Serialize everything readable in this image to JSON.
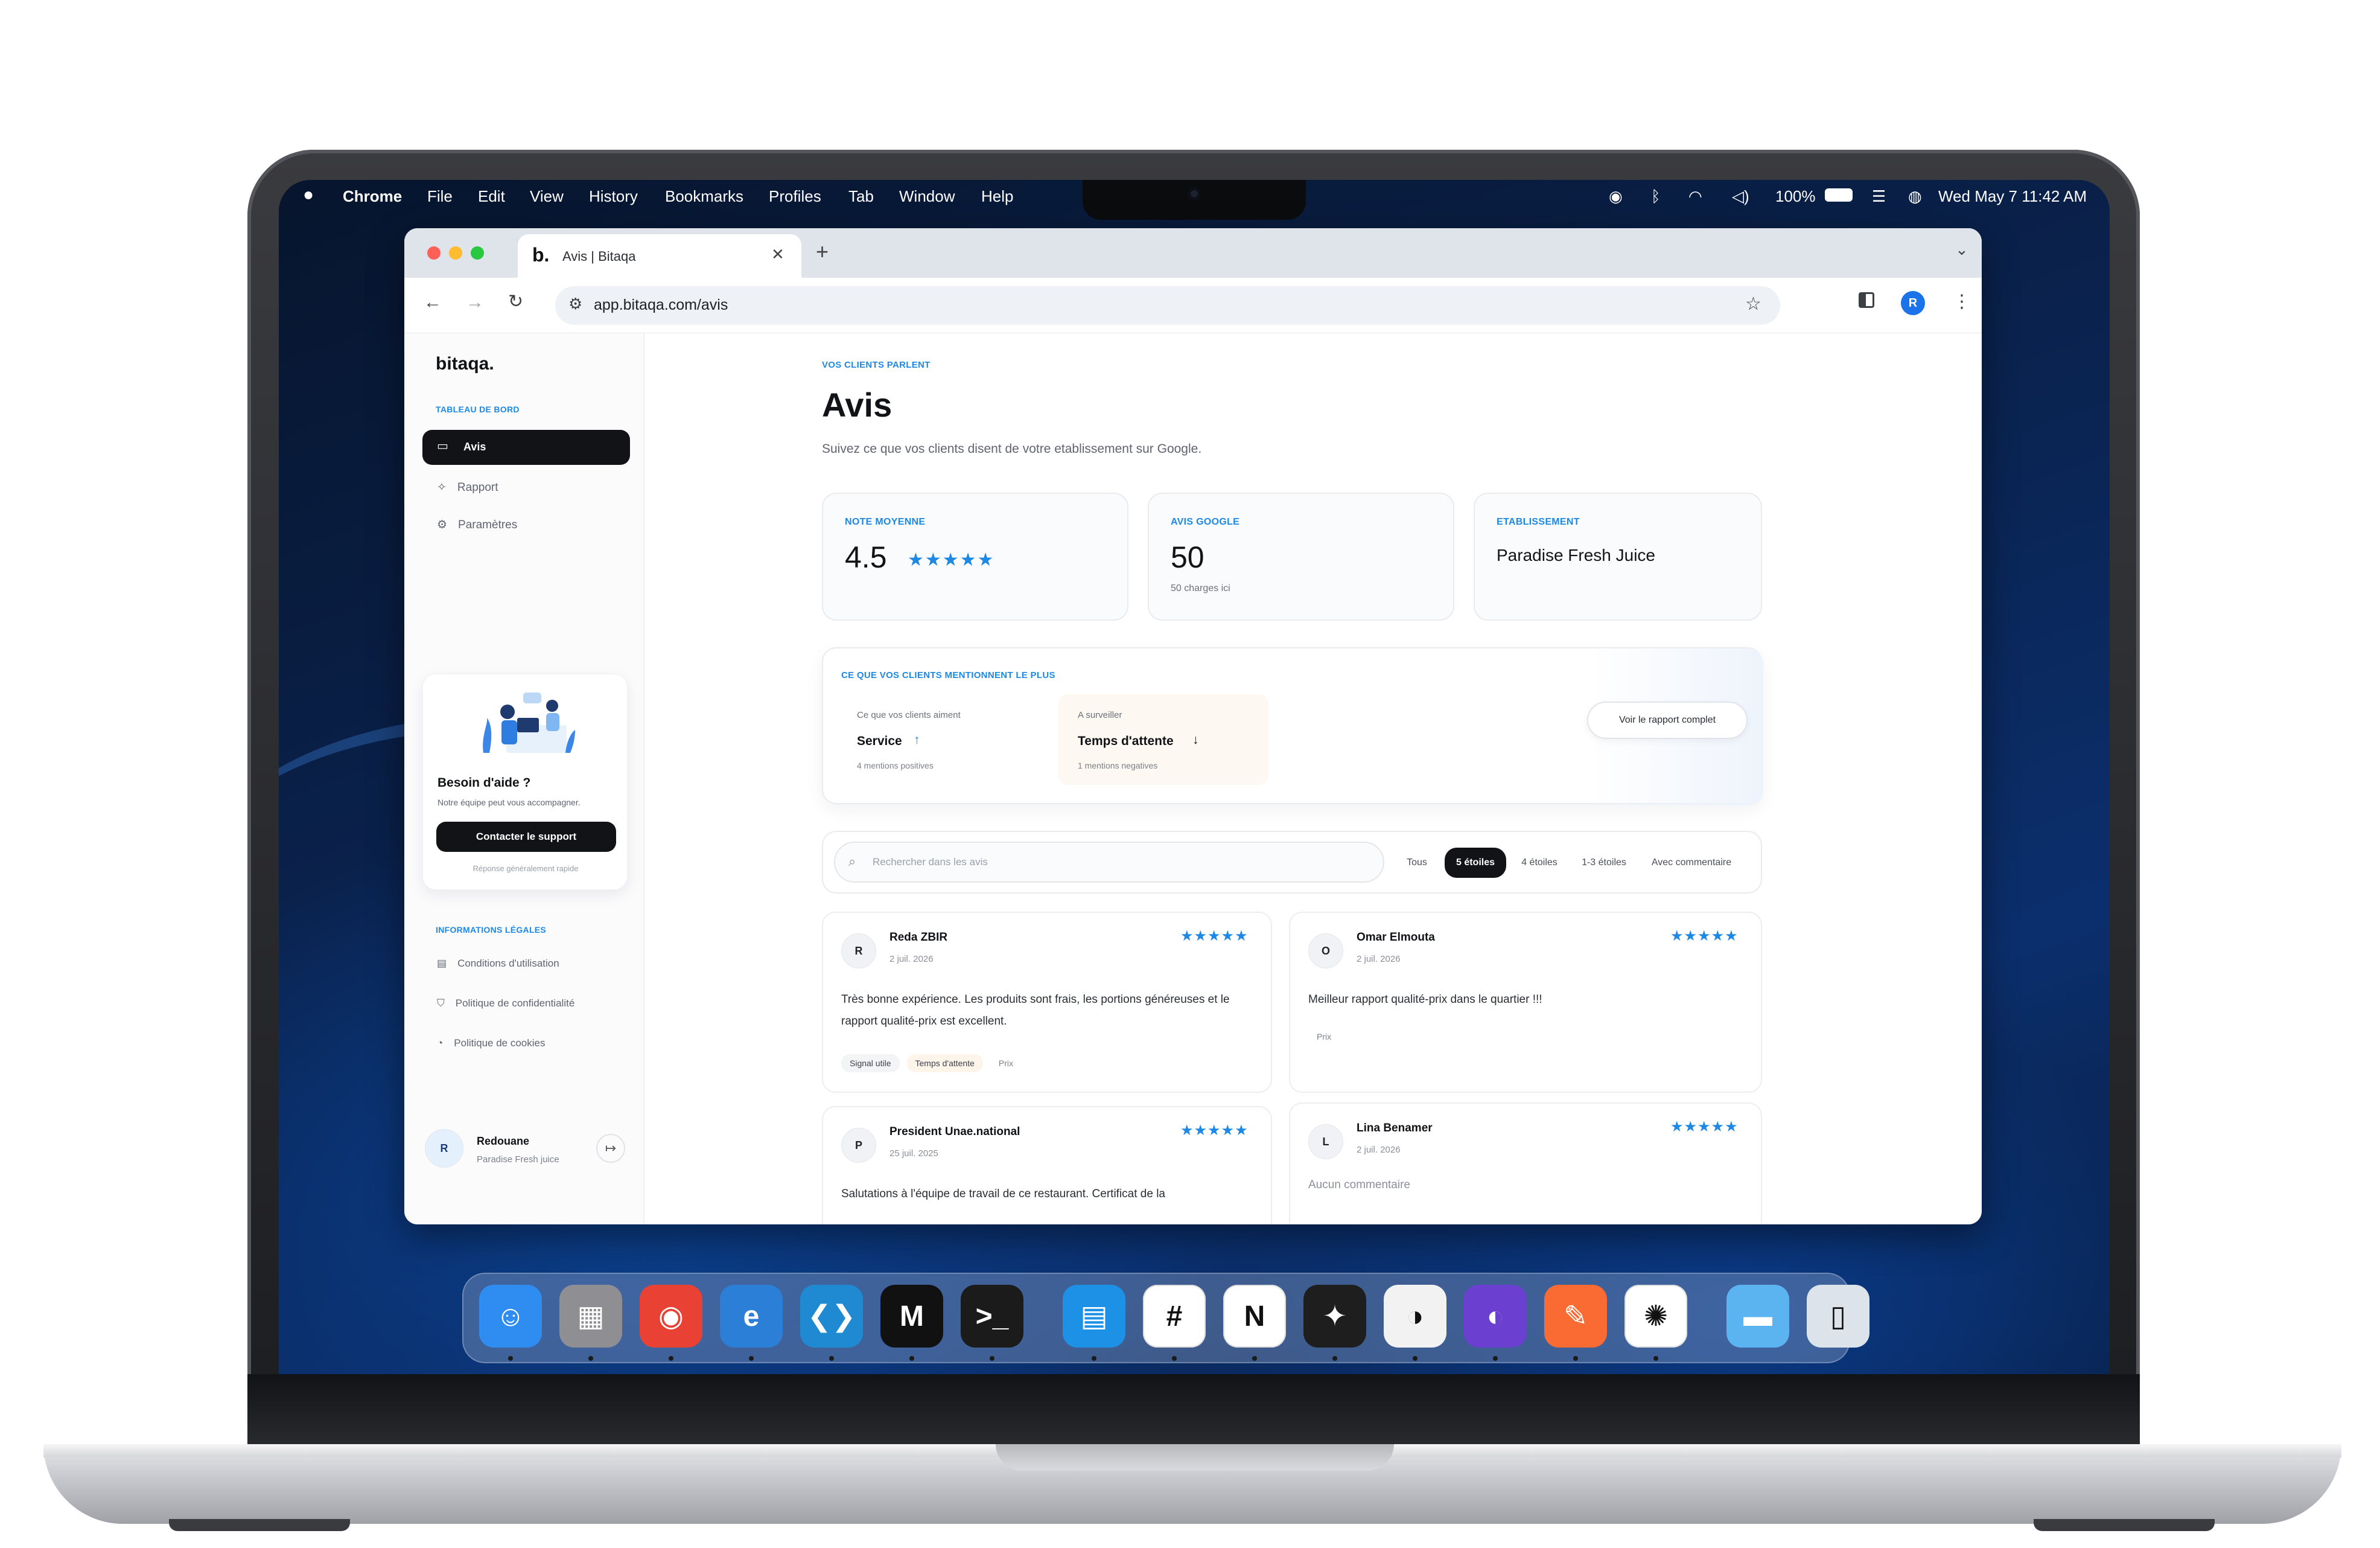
{
  "menubar": {
    "app": "Chrome",
    "items": [
      "File",
      "Edit",
      "View",
      "History",
      "Bookmarks",
      "Profiles",
      "Tab",
      "Window",
      "Help"
    ],
    "battery": "100%",
    "datetime": "Wed May 7  11:42 AM"
  },
  "browser": {
    "tab_title": "Avis | Bitaqa",
    "url": "app.bitaqa.com/avis",
    "profile_initial": "R"
  },
  "sidebar": {
    "logo": "bitaqa.",
    "section_dashboard": "TABLEAU DE BORD",
    "nav": [
      {
        "label": "Avis",
        "icon": "message-square-icon"
      },
      {
        "label": "Rapport",
        "icon": "sparkles-icon"
      },
      {
        "label": "Paramètres",
        "icon": "gear-icon"
      }
    ],
    "help": {
      "title": "Besoin d'aide ?",
      "text": "Notre équipe peut vous accompagner.",
      "button": "Contacter le support",
      "note": "Réponse généralement rapide"
    },
    "section_legal": "INFORMATIONS LÉGALES",
    "legal": [
      {
        "label": "Conditions d'utilisation",
        "icon": "document-icon"
      },
      {
        "label": "Politique de confidentialité",
        "icon": "shield-icon"
      },
      {
        "label": "Politique de cookies",
        "icon": "cookie-icon"
      }
    ],
    "user": {
      "initial": "R",
      "name": "Redouane",
      "business": "Paradise Fresh juice"
    }
  },
  "main": {
    "eyebrow": "VOS CLIENTS PARLENT",
    "title": "Avis",
    "subtitle": "Suivez ce que vos clients disent de votre etablissement sur Google.",
    "kpis": {
      "rating_title": "NOTE MOYENNE",
      "rating_value": "4.5",
      "rating_stars": "★★★★★",
      "google_title": "AVIS GOOGLE",
      "google_value": "50",
      "google_sub": "50 charges ici",
      "business_title": "ETABLISSEMENT",
      "business_value": "Paradise Fresh Juice"
    },
    "insights": {
      "title": "CE QUE VOS CLIENTS MENTIONNENT LE PLUS",
      "like_label": "Ce que vos clients aiment",
      "like_value": "Service",
      "like_arrow": "↑",
      "like_sub": "4 mentions positives",
      "watch_label": "A surveiller",
      "watch_value": "Temps d'attente",
      "watch_arrow": "↓",
      "watch_sub": "1 mentions negatives",
      "report_button": "Voir le rapport complet"
    },
    "search_placeholder": "Rechercher dans les avis",
    "filters": [
      "Tous",
      "5 étoiles",
      "4 étoiles",
      "1-3 étoiles",
      "Avec commentaire"
    ],
    "active_filter": "5 étoiles",
    "reviews": [
      {
        "initial": "R",
        "name": "Reda ZBIR",
        "date": "2 juil. 2026",
        "stars": "★★★★★",
        "text": "Très bonne expérience. Les produits sont frais, les portions généreuses et le rapport qualité-prix est excellent.",
        "tags": [
          "Signal utile",
          "Temps d'attente",
          "Prix"
        ]
      },
      {
        "initial": "O",
        "name": "Omar Elmouta",
        "date": "2 juil. 2026",
        "stars": "★★★★★",
        "text": "Meilleur rapport qualité-prix dans le quartier !!!",
        "tags": [
          "Prix"
        ]
      },
      {
        "initial": "P",
        "name": "President Unae.national",
        "date": "25 juil. 2025",
        "stars": "★★★★★",
        "text": "Salutations à l'équipe de travail de ce restaurant. Certificat de la",
        "tags": []
      },
      {
        "initial": "L",
        "name": "Lina Benamer",
        "date": "2 juil. 2026",
        "stars": "★★★★★",
        "text": "Aucun commentaire",
        "tags": []
      }
    ]
  },
  "dock": {
    "apps": [
      {
        "name": "finder-icon",
        "glyph": "☺",
        "color": "#2f8cf0"
      },
      {
        "name": "launchpad-icon",
        "glyph": "▦",
        "color": "#8e8e93"
      },
      {
        "name": "chrome-icon",
        "glyph": "◉",
        "color": "#e94235"
      },
      {
        "name": "edge-icon",
        "glyph": "e",
        "color": "#2b7fd6"
      },
      {
        "name": "vscode-icon",
        "glyph": "❮❯",
        "color": "#1f8ad2"
      },
      {
        "name": "markdown-app-icon",
        "glyph": "M",
        "color": "#111111"
      },
      {
        "name": "terminal-icon",
        "glyph": ">_",
        "color": "#1b1b1b"
      },
      {
        "name": "docker-icon",
        "glyph": "▤",
        "color": "#1d91e6"
      },
      {
        "name": "slack-icon",
        "glyph": "#",
        "color": "#ffffff"
      },
      {
        "name": "notion-icon",
        "glyph": "N",
        "color": "#ffffff"
      },
      {
        "name": "figma-icon",
        "glyph": "✦",
        "color": "#1e1e1e"
      },
      {
        "name": "linear-icon",
        "glyph": "◑",
        "color": "#f2f2f2"
      },
      {
        "name": "github-icon",
        "glyph": "◐",
        "color": "#6b3fcf"
      },
      {
        "name": "postman-icon",
        "glyph": "✎",
        "color": "#fa6a33"
      },
      {
        "name": "chatgpt-icon",
        "glyph": "✺",
        "color": "#ffffff"
      },
      {
        "name": "folder-icon",
        "glyph": "▬",
        "color": "#5bb4f0"
      },
      {
        "name": "trash-icon",
        "glyph": "▯",
        "color": "#dde3ea"
      }
    ]
  }
}
